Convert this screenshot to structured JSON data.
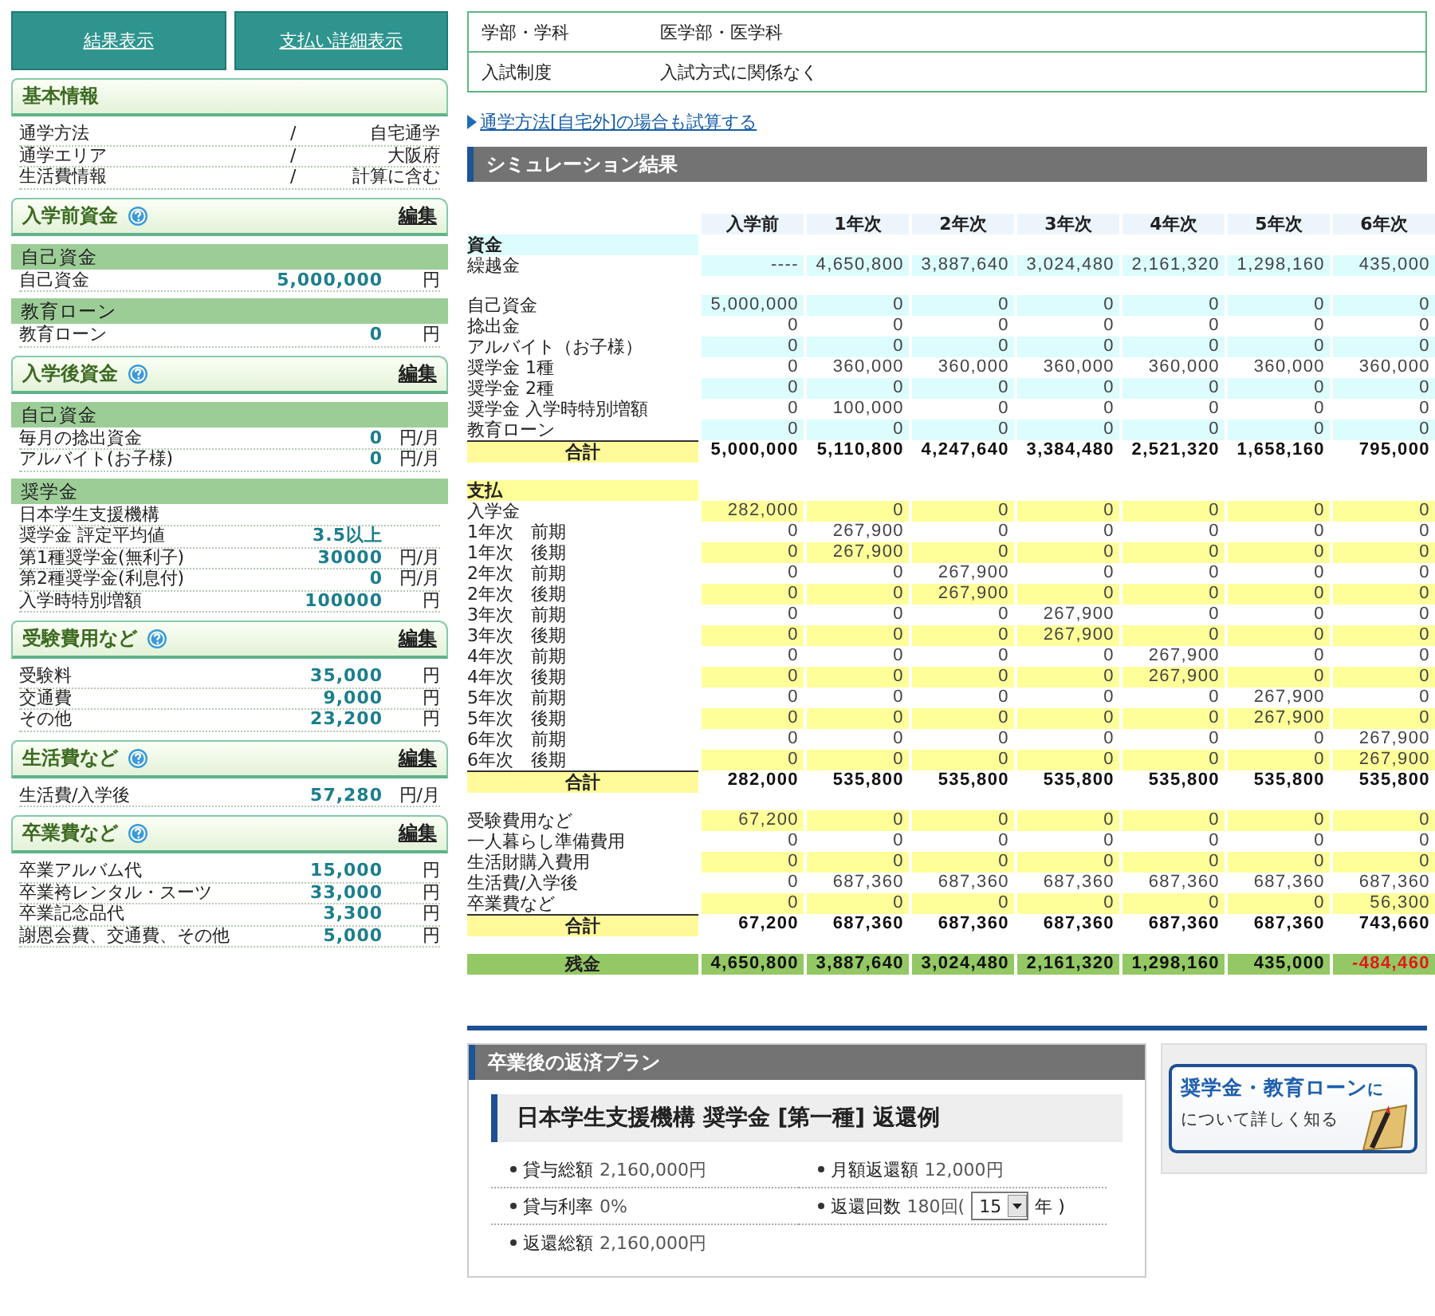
{
  "side_buttons": [
    "結果表示",
    "支払い詳細表示"
  ],
  "side_sections": [
    {
      "title": "基本情報",
      "help": false,
      "items": [
        {
          "kind": "pair",
          "label": "通学方法",
          "sep": "/",
          "value": "自宅通学"
        },
        {
          "kind": "pair",
          "label": "通学エリア",
          "sep": "/",
          "value": "大阪府"
        },
        {
          "kind": "pair",
          "label": "生活費情報",
          "sep": "/",
          "value": "計算に含む"
        }
      ]
    },
    {
      "title": "入学前資金",
      "help": true,
      "edit": "編集",
      "items": [
        {
          "kind": "subhead",
          "label": "自己資金"
        },
        {
          "kind": "amount",
          "label": "自己資金",
          "value": "5,000,000",
          "unit": "円"
        },
        {
          "kind": "subhead",
          "label": "教育ローン"
        },
        {
          "kind": "amount",
          "label": "教育ローン",
          "value": "0",
          "unit": "円"
        }
      ]
    },
    {
      "title": "入学後資金",
      "help": true,
      "edit": "編集",
      "items": [
        {
          "kind": "subhead",
          "label": "自己資金"
        },
        {
          "kind": "amount",
          "label": "毎月の捻出資金",
          "value": "0",
          "unit": "円/月"
        },
        {
          "kind": "amount",
          "label": "アルバイト(お子様)",
          "value": "0",
          "unit": "円/月"
        },
        {
          "kind": "subhead",
          "label": "奨学金"
        },
        {
          "kind": "amount",
          "label": "日本学生支援機構"
        },
        {
          "kind": "amount",
          "label": "奨学金 評定平均値",
          "value": "3.5以上"
        },
        {
          "kind": "amount",
          "label": "第1種奨学金(無利子)",
          "value": "30000",
          "unit": "円/月"
        },
        {
          "kind": "amount",
          "label": "第2種奨学金(利息付)",
          "value": "0",
          "unit": "円/月"
        },
        {
          "kind": "amount",
          "label": "入学時特別増額",
          "value": "100000",
          "unit": "円"
        }
      ]
    },
    {
      "title": "受験費用など",
      "help": true,
      "edit": "編集",
      "items": [
        {
          "kind": "amount",
          "label": "受験料",
          "value": "35,000",
          "unit": "円"
        },
        {
          "kind": "amount",
          "label": "交通費",
          "value": "9,000",
          "unit": "円"
        },
        {
          "kind": "amount",
          "label": "その他",
          "value": "23,200",
          "unit": "円"
        }
      ]
    },
    {
      "title": "生活費など",
      "help": true,
      "edit": "編集",
      "items": [
        {
          "kind": "amount",
          "label": "生活費/入学後",
          "value": "57,280",
          "unit": "円/月"
        }
      ]
    },
    {
      "title": "卒業費など",
      "help": true,
      "edit": "編集",
      "items": [
        {
          "kind": "amount",
          "label": "卒業アルバム代",
          "value": "15,000",
          "unit": "円"
        },
        {
          "kind": "amount",
          "label": "卒業袴レンタル・スーツ",
          "value": "33,000",
          "unit": "円"
        },
        {
          "kind": "amount",
          "label": "卒業記念品代",
          "value": "3,300",
          "unit": "円"
        },
        {
          "kind": "amount",
          "label": "謝恩会費、交通費、その他",
          "value": "5,000",
          "unit": "円"
        }
      ]
    }
  ],
  "info_rows": [
    {
      "label": "学部・学科",
      "value": "医学部・医学科"
    },
    {
      "label": "入試制度",
      "value": "入試方式に関係なく"
    }
  ],
  "alt_link": "通学方法[自宅外]の場合も試算する",
  "simulation": {
    "title": "シミュレーション結果",
    "columns": [
      "入学前",
      "1年次",
      "2年次",
      "3年次",
      "4年次",
      "5年次",
      "6年次"
    ],
    "blocks": [
      {
        "title": "資金",
        "color": "#dcfcfd",
        "rows": [
          {
            "label": "繰越金",
            "shaded": true,
            "values": [
              "----",
              "4,650,800",
              "3,887,640",
              "3,024,480",
              "2,161,320",
              "1,298,160",
              "435,000"
            ]
          }
        ]
      },
      {
        "color": "#dcfcfd",
        "rows": [
          {
            "label": "自己資金",
            "shaded": true,
            "values": [
              "5,000,000",
              "0",
              "0",
              "0",
              "0",
              "0",
              "0"
            ]
          },
          {
            "label": "捻出金",
            "shaded": false,
            "values": [
              "0",
              "0",
              "0",
              "0",
              "0",
              "0",
              "0"
            ]
          },
          {
            "label": "アルバイト（お子様）",
            "shaded": true,
            "values": [
              "0",
              "0",
              "0",
              "0",
              "0",
              "0",
              "0"
            ]
          },
          {
            "label": "奨学金 1種",
            "shaded": false,
            "values": [
              "0",
              "360,000",
              "360,000",
              "360,000",
              "360,000",
              "360,000",
              "360,000"
            ]
          },
          {
            "label": "奨学金 2種",
            "shaded": true,
            "values": [
              "0",
              "0",
              "0",
              "0",
              "0",
              "0",
              "0"
            ]
          },
          {
            "label": "奨学金 入学時特別増額",
            "shaded": false,
            "values": [
              "0",
              "100,000",
              "0",
              "0",
              "0",
              "0",
              "0"
            ]
          },
          {
            "label": "教育ローン",
            "shaded": true,
            "values": [
              "0",
              "0",
              "0",
              "0",
              "0",
              "0",
              "0"
            ]
          }
        ],
        "total": {
          "label": "合計",
          "values": [
            "5,000,000",
            "5,110,800",
            "4,247,640",
            "3,384,480",
            "2,521,320",
            "1,658,160",
            "795,000"
          ]
        }
      },
      {
        "title": "支払",
        "color": "#ffff99",
        "rows": [
          {
            "label": "入学金",
            "shaded": true,
            "values": [
              "282,000",
              "0",
              "0",
              "0",
              "0",
              "0",
              "0"
            ]
          },
          {
            "label": "1年次　前期",
            "shaded": false,
            "values": [
              "0",
              "267,900",
              "0",
              "0",
              "0",
              "0",
              "0"
            ]
          },
          {
            "label": "1年次　後期",
            "shaded": true,
            "values": [
              "0",
              "267,900",
              "0",
              "0",
              "0",
              "0",
              "0"
            ]
          },
          {
            "label": "2年次　前期",
            "shaded": false,
            "values": [
              "0",
              "0",
              "267,900",
              "0",
              "0",
              "0",
              "0"
            ]
          },
          {
            "label": "2年次　後期",
            "shaded": true,
            "values": [
              "0",
              "0",
              "267,900",
              "0",
              "0",
              "0",
              "0"
            ]
          },
          {
            "label": "3年次　前期",
            "shaded": false,
            "values": [
              "0",
              "0",
              "0",
              "267,900",
              "0",
              "0",
              "0"
            ]
          },
          {
            "label": "3年次　後期",
            "shaded": true,
            "values": [
              "0",
              "0",
              "0",
              "267,900",
              "0",
              "0",
              "0"
            ]
          },
          {
            "label": "4年次　前期",
            "shaded": false,
            "values": [
              "0",
              "0",
              "0",
              "0",
              "267,900",
              "0",
              "0"
            ]
          },
          {
            "label": "4年次　後期",
            "shaded": true,
            "values": [
              "0",
              "0",
              "0",
              "0",
              "267,900",
              "0",
              "0"
            ]
          },
          {
            "label": "5年次　前期",
            "shaded": false,
            "values": [
              "0",
              "0",
              "0",
              "0",
              "0",
              "267,900",
              "0"
            ]
          },
          {
            "label": "5年次　後期",
            "shaded": true,
            "values": [
              "0",
              "0",
              "0",
              "0",
              "0",
              "267,900",
              "0"
            ]
          },
          {
            "label": "6年次　前期",
            "shaded": false,
            "values": [
              "0",
              "0",
              "0",
              "0",
              "0",
              "0",
              "267,900"
            ]
          },
          {
            "label": "6年次　後期",
            "shaded": true,
            "values": [
              "0",
              "0",
              "0",
              "0",
              "0",
              "0",
              "267,900"
            ]
          }
        ],
        "total": {
          "label": "合計",
          "values": [
            "282,000",
            "535,800",
            "535,800",
            "535,800",
            "535,800",
            "535,800",
            "535,800"
          ]
        }
      },
      {
        "color": "#ffff99",
        "rows": [
          {
            "label": "受験費用など",
            "shaded": true,
            "values": [
              "67,200",
              "0",
              "0",
              "0",
              "0",
              "0",
              "0"
            ]
          },
          {
            "label": "一人暮らし準備費用",
            "shaded": false,
            "values": [
              "0",
              "0",
              "0",
              "0",
              "0",
              "0",
              "0"
            ]
          },
          {
            "label": "生活財購入費用",
            "shaded": true,
            "values": [
              "0",
              "0",
              "0",
              "0",
              "0",
              "0",
              "0"
            ]
          },
          {
            "label": "生活費/入学後",
            "shaded": false,
            "values": [
              "0",
              "687,360",
              "687,360",
              "687,360",
              "687,360",
              "687,360",
              "687,360"
            ]
          },
          {
            "label": "卒業費など",
            "shaded": true,
            "values": [
              "0",
              "0",
              "0",
              "0",
              "0",
              "0",
              "56,300"
            ]
          }
        ],
        "total": {
          "label": "合計",
          "values": [
            "67,200",
            "687,360",
            "687,360",
            "687,360",
            "687,360",
            "687,360",
            "743,660"
          ]
        }
      }
    ],
    "balance": {
      "label": "残金",
      "values": [
        "4,650,800",
        "3,887,640",
        "3,024,480",
        "2,161,320",
        "1,298,160",
        "435,000",
        "-484,460"
      ],
      "negative": [
        false,
        false,
        false,
        false,
        false,
        false,
        true
      ]
    }
  },
  "repayment": {
    "title": "卒業後の返済プラン",
    "subtitle": "日本学生支援機構 奨学金 [第一種] 返還例",
    "items": [
      {
        "kind": "text",
        "label": "貸与総額",
        "value": "2,160,000円"
      },
      {
        "kind": "text",
        "label": "月額返還額",
        "value": "12,000円"
      },
      {
        "kind": "text",
        "label": "貸与利率",
        "value": "0%"
      },
      {
        "kind": "select",
        "label": "返還回数",
        "value": "180回(",
        "select": "15",
        "after": "年 )"
      },
      {
        "kind": "text",
        "label": "返還総額",
        "value": "2,160,000円"
      }
    ]
  },
  "banner": {
    "headline": "奨学金・教育ローン",
    "headline_tail": "に",
    "subline": "について詳しく知る"
  }
}
